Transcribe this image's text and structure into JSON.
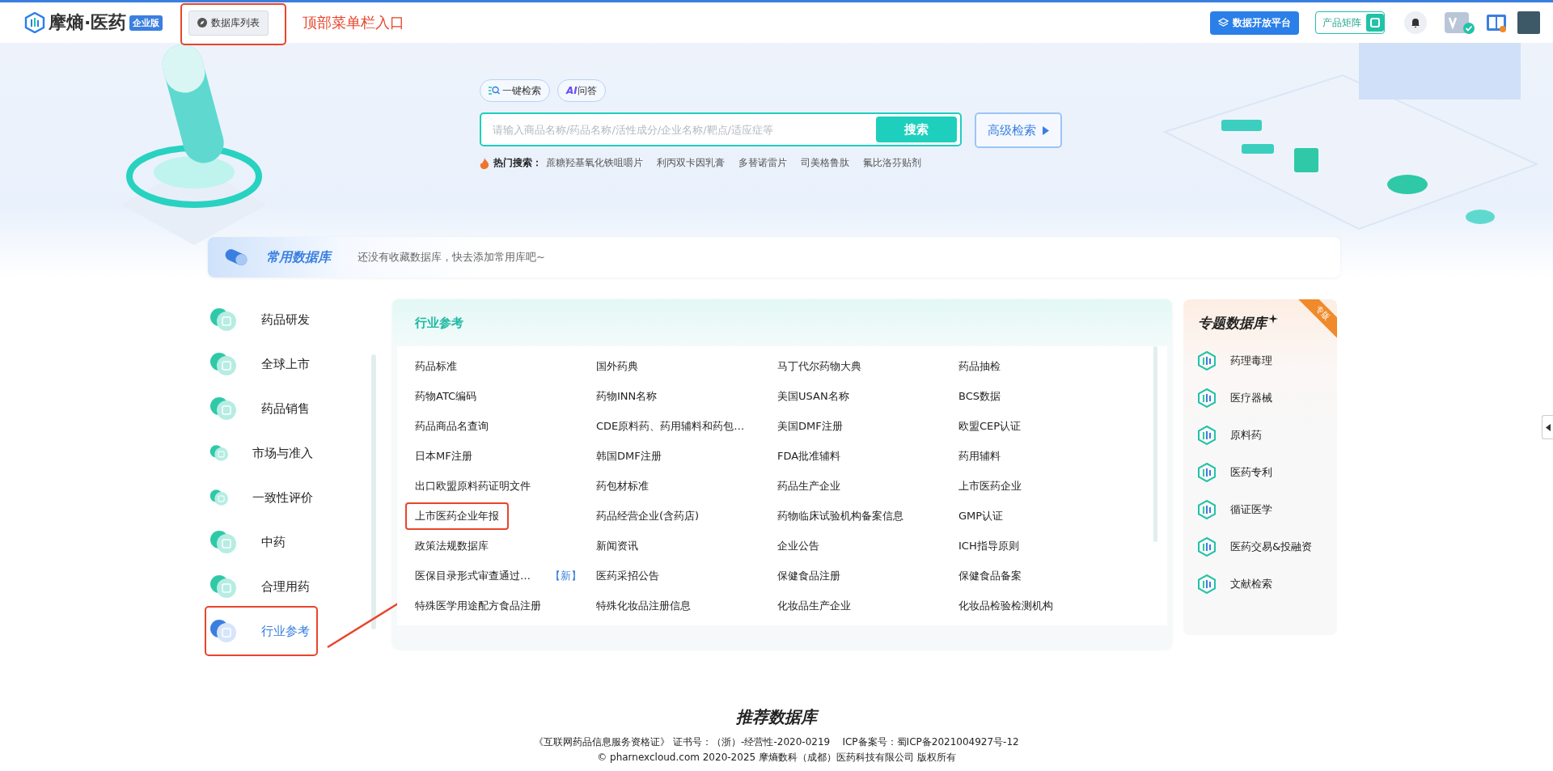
{
  "top_bar": {
    "logo": {
      "name": "摩熵·医药",
      "badge": "企业版"
    },
    "db_list_button": {
      "label": "数据库列表",
      "highlighted": true
    },
    "annotation_label": "顶部菜单栏入口",
    "open_platform_button": "数据开放平台",
    "product_matrix_button": "产品矩阵"
  },
  "search": {
    "modes": [
      {
        "kind": "search",
        "label": "一键检索"
      },
      {
        "kind": "ai",
        "label": "**AI**问答"
      }
    ],
    "placeholder": "请输入商品名称/药品名称/活性成分/企业名称/靶点/适应症等",
    "button": "搜索",
    "advanced_button": "高级检索",
    "hot_label": "热门搜索：",
    "hot_terms": [
      "蔗糖羟基氧化铁咀嚼片",
      "利丙双卡因乳膏",
      "多替诺雷片",
      "司美格鲁肽",
      "氟比洛芬贴剂"
    ]
  },
  "favorites": {
    "title": "常用数据库",
    "message": "还没有收藏数据库，快去添加常用库吧~"
  },
  "sidebar": {
    "items": [
      {
        "label": "药品研发",
        "selected": false,
        "highlighted": false
      },
      {
        "label": "全球上市",
        "selected": false,
        "highlighted": false
      },
      {
        "label": "药品销售",
        "selected": false,
        "highlighted": false
      },
      {
        "label": "市场与准入",
        "selected": false,
        "highlighted": false
      },
      {
        "label": "一致性评价",
        "selected": false,
        "highlighted": false
      },
      {
        "label": "中药",
        "selected": false,
        "highlighted": false
      },
      {
        "label": "合理用药",
        "selected": false,
        "highlighted": false
      },
      {
        "label": "行业参考",
        "selected": true,
        "highlighted": true
      }
    ]
  },
  "industry_panel": {
    "title": "行业参考",
    "items": [
      {
        "label": "药品标准",
        "highlighted": false
      },
      {
        "label": "国外药典",
        "highlighted": false
      },
      {
        "label": "马丁代尔药物大典",
        "highlighted": false
      },
      {
        "label": "药品抽检",
        "highlighted": false
      },
      {
        "label": "药物ATC编码",
        "highlighted": false
      },
      {
        "label": "药物INN名称",
        "highlighted": false
      },
      {
        "label": "美国USAN名称",
        "highlighted": false
      },
      {
        "label": "BCS数据",
        "highlighted": false
      },
      {
        "label": "药品商品名查询",
        "highlighted": false
      },
      {
        "label": "CDE原料药、药用辅料和药包…",
        "highlighted": false
      },
      {
        "label": "美国DMF注册",
        "highlighted": false
      },
      {
        "label": "欧盟CEP认证",
        "highlighted": false
      },
      {
        "label": "日本MF注册",
        "highlighted": false
      },
      {
        "label": "韩国DMF注册",
        "highlighted": false
      },
      {
        "label": "FDA批准辅料",
        "highlighted": false
      },
      {
        "label": "药用辅料",
        "highlighted": false
      },
      {
        "label": "出口欧盟原料药证明文件",
        "highlighted": false
      },
      {
        "label": "药包材标准",
        "highlighted": false
      },
      {
        "label": "药品生产企业",
        "highlighted": false
      },
      {
        "label": "上市医药企业",
        "highlighted": false
      },
      {
        "label": "上市医药企业年报",
        "highlighted": true
      },
      {
        "label": "药品经营企业(含药店)",
        "highlighted": false
      },
      {
        "label": "药物临床试验机构备案信息",
        "highlighted": false
      },
      {
        "label": "GMP认证",
        "highlighted": false
      },
      {
        "label": "政策法规数据库",
        "highlighted": false
      },
      {
        "label": "新闻资讯",
        "highlighted": false
      },
      {
        "label": "企业公告",
        "highlighted": false
      },
      {
        "label": "ICH指导原则",
        "highlighted": false
      },
      {
        "label": "医保目录形式审查通过…",
        "badge": "【新】",
        "highlighted": false
      },
      {
        "label": "医药采招公告",
        "highlighted": false
      },
      {
        "label": "保健食品注册",
        "highlighted": false
      },
      {
        "label": "保健食品备案",
        "highlighted": false
      },
      {
        "label": "特殊医学用途配方食品注册",
        "highlighted": false
      },
      {
        "label": "特殊化妆品注册信息",
        "highlighted": false
      },
      {
        "label": "化妆品生产企业",
        "highlighted": false
      },
      {
        "label": "化妆品检验检测机构",
        "highlighted": false
      }
    ]
  },
  "special_panel": {
    "title": "专题数据库",
    "ribbon": "专版",
    "items": [
      "药理毒理",
      "医疗器械",
      "原料药",
      "医药专利",
      "循证医学",
      "医药交易&投融资",
      "文献检索"
    ]
  },
  "footer": {
    "title": "推荐数据库",
    "lines": [
      "《互联网药品信息服务资格证》 证书号：（浙）-经营性-2020-0219    ICP备案号：蜀ICP备2021004927号-12",
      "© pharnexcloud.com 2020-2025 摩熵数科（成都）医药科技有限公司 版权所有"
    ]
  }
}
